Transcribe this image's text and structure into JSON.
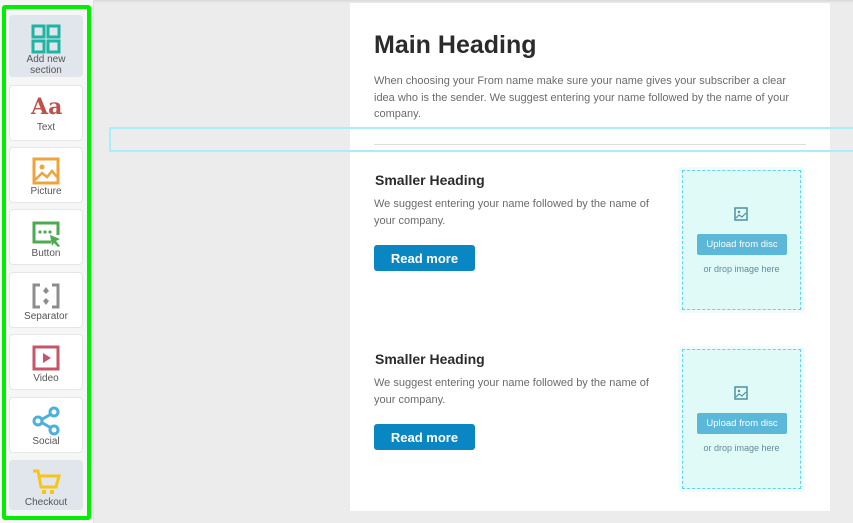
{
  "sidebar": {
    "items": [
      {
        "id": "add-section",
        "label": "Add new section",
        "icon": "grid-icon",
        "active": true
      },
      {
        "id": "text",
        "label": "Text",
        "icon": "text-icon"
      },
      {
        "id": "picture",
        "label": "Picture",
        "icon": "picture-icon"
      },
      {
        "id": "button",
        "label": "Button",
        "icon": "button-icon"
      },
      {
        "id": "separator",
        "label": "Separator",
        "icon": "separator-icon"
      },
      {
        "id": "video",
        "label": "Video",
        "icon": "video-icon"
      },
      {
        "id": "social",
        "label": "Social",
        "icon": "share-icon"
      },
      {
        "id": "checkout",
        "label": "Checkout",
        "icon": "cart-icon",
        "active": true
      }
    ],
    "text_icon_glyph": "Aa",
    "colors": {
      "highlight": "#00ee00",
      "grid": "#1fb5a3",
      "text": "#c0514a",
      "picture": "#f0a33a",
      "button": "#4caa4f",
      "separator": "#8e8e8e",
      "video": "#c9546a",
      "social": "#4bb0dc",
      "checkout": "#f5c518"
    }
  },
  "canvas": {
    "main_heading": "Main Heading",
    "intro": "When choosing your From name make sure your name gives your subscriber a clear idea who is the sender. We suggest entering your name followed by the name of your company.",
    "rows": [
      {
        "heading": "Smaller Heading",
        "body": "We suggest entering your name followed by the name of your company.",
        "button": "Read more",
        "upload_button": "Upload from disc",
        "drop_hint": "or drop image here"
      },
      {
        "heading": "Smaller Heading",
        "body": "We suggest entering your name followed by the name of your company.",
        "button": "Read more",
        "upload_button": "Upload from disc",
        "drop_hint": "or drop image here"
      }
    ],
    "colors": {
      "button": "#0a86c2",
      "upload_button": "#5bb8d8",
      "drop_border": "#5fd6ea",
      "drop_guide": "#a9eef8"
    }
  }
}
